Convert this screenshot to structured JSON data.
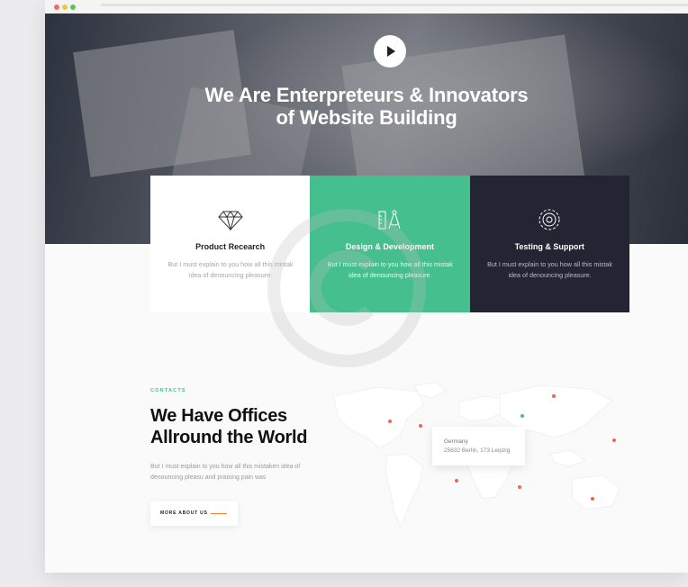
{
  "colors": {
    "accent_green": "#45bf8e",
    "dark_card": "#232632",
    "marker_red": "#f0644e",
    "marker_green": "#45bf8e",
    "button_line": "#f0823c"
  },
  "hero": {
    "play_icon": "play-icon",
    "title_line1": "We Are Enterpreteurs & Innovators",
    "title_line2": "of Website Building"
  },
  "services": [
    {
      "icon": "diamond-icon",
      "title": "Product Recearch",
      "text": "But I must explain to you how all this mistak idea of denouncing pleasure."
    },
    {
      "icon": "compass-ruler-icon",
      "title": "Design & Development",
      "text": "But I must explain to you how all this mistak idea of denouncing pleasure."
    },
    {
      "icon": "support-icon",
      "title": "Testing & Support",
      "text": "But I must explain to you how all this mistak idea of denouncing pleasure."
    }
  ],
  "contacts": {
    "eyebrow": "CONTACTS",
    "title_line1": "We Have Offices",
    "title_line2": "Allround the World",
    "text": "But I must explain to you how all this mistaken idea of denouncing pleasu and praising pain was",
    "button_label": "MORE ABOUT US"
  },
  "map": {
    "icon": "world-map",
    "tooltip": {
      "city": "Germany",
      "address": "25632 Berlin, 173 Leipzig"
    }
  }
}
